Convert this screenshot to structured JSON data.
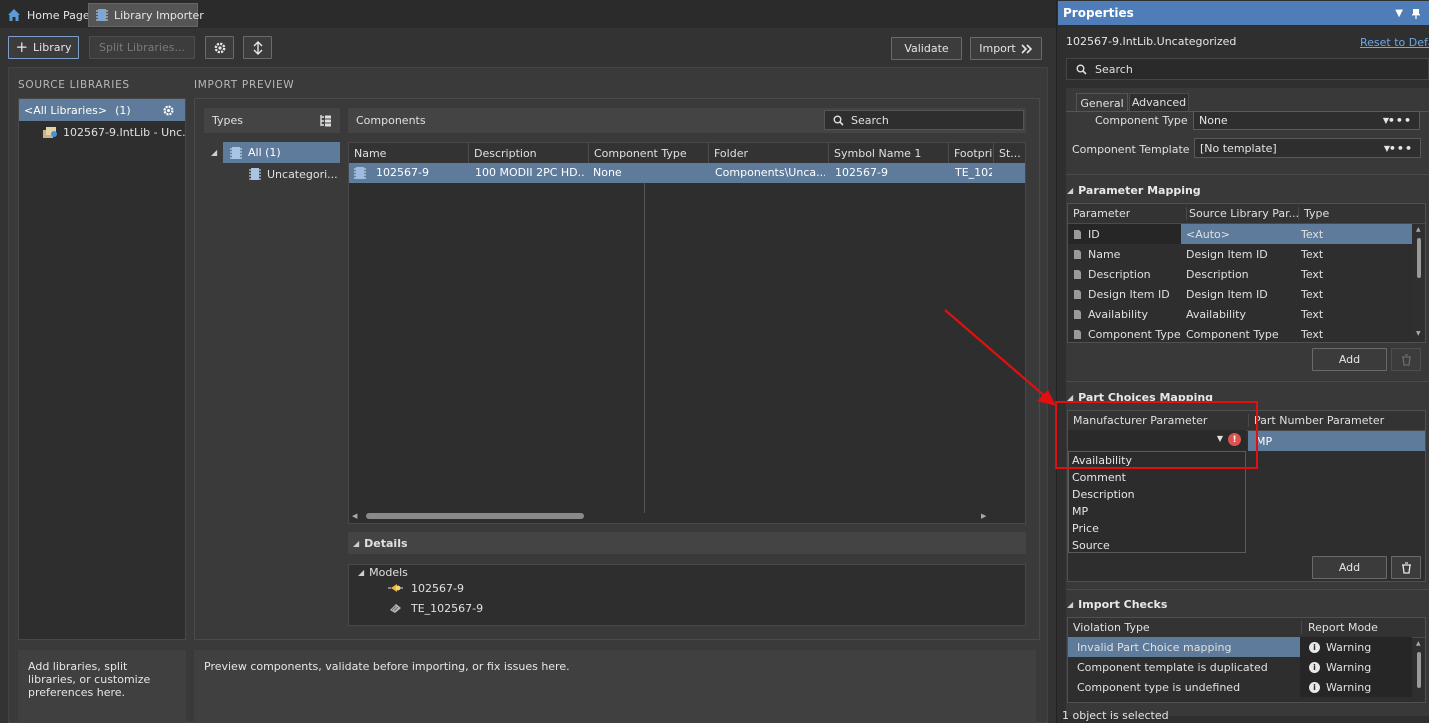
{
  "tabs": [
    {
      "label": "Home Page",
      "icon": "home-icon"
    },
    {
      "label": "Library Importer",
      "icon": "library-icon"
    }
  ],
  "toolbar": {
    "library_label": "Library",
    "split_label": "Split Libraries...",
    "validate_label": "Validate",
    "import_label": "Import"
  },
  "source_libraries": {
    "header": "SOURCE LIBRARIES",
    "all_label": "<All Libraries>",
    "all_count": "(1)",
    "items": [
      "102567-9.IntLib - Unc..."
    ]
  },
  "import_preview": {
    "header": "IMPORT PREVIEW",
    "types_label": "Types",
    "types_tree": {
      "all": "All (1)",
      "child": "Uncategori..."
    },
    "components_label": "Components",
    "search_placeholder": "Search",
    "columns": [
      "Name",
      "Description",
      "Component Type",
      "Folder",
      "Symbol Name 1",
      "Footpri",
      "St..."
    ],
    "rows": [
      {
        "name": "102567-9",
        "description": "100 MODII 2PC HD...",
        "type": "None",
        "folder": "Components\\Unca...",
        "symbol": "102567-9",
        "footprint": "TE_102"
      }
    ],
    "details_label": "Details",
    "models_label": "Models",
    "models": [
      "102567-9",
      "TE_102567-9"
    ]
  },
  "hints": {
    "left": "Add libraries, split libraries, or customize preferences here.",
    "right": "Preview components, validate before importing, or fix issues here."
  },
  "properties": {
    "title": "Properties",
    "object_name": "102567-9.IntLib.Uncategorized",
    "reset_label": "Reset to Defa",
    "search_placeholder": "Search",
    "tab_general": "General",
    "tab_advanced": "Advanced",
    "component_type_label": "Component Type",
    "component_type_value": "None",
    "component_template_label": "Component Template",
    "component_template_value": "[No template]",
    "parameter_mapping": {
      "title": "Parameter Mapping",
      "columns": [
        "Parameter",
        "Source Library Par...",
        "Type"
      ],
      "rows": [
        {
          "param": "ID",
          "source": "<Auto>",
          "type": "Text"
        },
        {
          "param": "Name",
          "source": "Design Item ID",
          "type": "Text"
        },
        {
          "param": "Description",
          "source": "Description",
          "type": "Text"
        },
        {
          "param": "Design Item ID",
          "source": "Design Item ID",
          "type": "Text"
        },
        {
          "param": "Availability",
          "source": "Availability",
          "type": "Text"
        },
        {
          "param": "Component Type",
          "source": "Component Type",
          "type": "Text"
        }
      ],
      "add_label": "Add"
    },
    "part_choices": {
      "title": "Part Choices Mapping",
      "columns": [
        "Manufacturer Parameter",
        "Part Number Parameter"
      ],
      "row_value": "MP",
      "dropdown_options": [
        "Availability",
        "Comment",
        "Description",
        "MP",
        "Price",
        "Source"
      ],
      "add_label": "Add"
    },
    "import_checks": {
      "title": "Import Checks",
      "columns": [
        "Violation Type",
        "Report Mode"
      ],
      "rows": [
        {
          "violation": "Invalid Part Choice mapping",
          "mode": "Warning"
        },
        {
          "violation": "Component template is duplicated",
          "mode": "Warning"
        },
        {
          "violation": "Component type is undefined",
          "mode": "Warning"
        }
      ]
    },
    "status": "1 object is selected"
  },
  "colors": {
    "selection": "#5e7b9c",
    "highlight_box": "#e01010",
    "arrow": "#e01010",
    "panel_header": "#4f7db8"
  }
}
